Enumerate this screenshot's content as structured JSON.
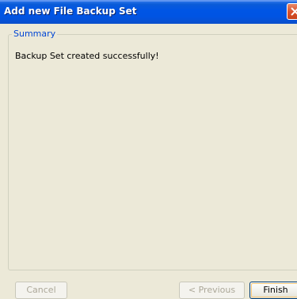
{
  "window": {
    "title": "Add new File Backup Set"
  },
  "summary": {
    "legend": "Summary",
    "message": "Backup Set created successfully!"
  },
  "buttons": {
    "cancel_label": "Cancel",
    "previous_label": "< Previous",
    "finish_label": "Finish"
  },
  "icons": {
    "close": "close-icon"
  },
  "colors": {
    "titlebar": "#0054E3",
    "close_button": "#D9542F",
    "legend_text": "#0046D5",
    "disabled_text": "#ACA899"
  },
  "state": {
    "cancel_enabled": false,
    "previous_enabled": false,
    "finish_enabled": true,
    "default_button": "finish"
  }
}
